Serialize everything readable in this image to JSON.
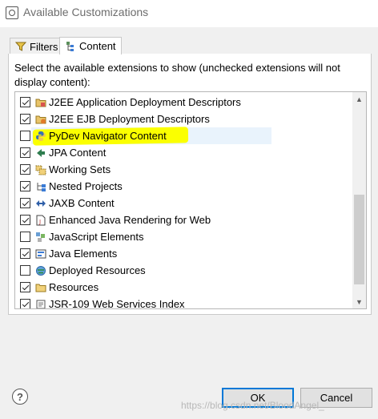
{
  "window": {
    "title": "Available Customizations",
    "icon": "customize-dialog-icon"
  },
  "tabs": [
    {
      "label": "Filters",
      "icon": "filter-icon",
      "active": false
    },
    {
      "label": "Content",
      "icon": "content-tree-icon",
      "active": true
    }
  ],
  "instructions": "Select the available extensions to show (unchecked extensions will not display content):",
  "extensions": [
    {
      "label": "J2EE Application Deployment Descriptors",
      "checked": true,
      "icon": "folder-descriptor-icon"
    },
    {
      "label": "J2EE EJB Deployment Descriptors",
      "checked": true,
      "icon": "ejb-descriptor-icon"
    },
    {
      "label": "PyDev Navigator Content",
      "checked": false,
      "icon": "python-icon",
      "selected": true,
      "highlighted": true
    },
    {
      "label": "JPA Content",
      "checked": true,
      "icon": "jpa-icon"
    },
    {
      "label": "Working Sets",
      "checked": true,
      "icon": "working-sets-icon"
    },
    {
      "label": "Nested Projects",
      "checked": true,
      "icon": "nested-projects-icon"
    },
    {
      "label": "JAXB Content",
      "checked": true,
      "icon": "jaxb-icon"
    },
    {
      "label": "Enhanced Java Rendering for Web",
      "checked": true,
      "icon": "java-file-icon"
    },
    {
      "label": "JavaScript Elements",
      "checked": false,
      "icon": "javascript-elements-icon"
    },
    {
      "label": "Java Elements",
      "checked": true,
      "icon": "java-elements-icon"
    },
    {
      "label": "Deployed Resources",
      "checked": false,
      "icon": "deployed-resources-icon"
    },
    {
      "label": "Resources",
      "checked": true,
      "icon": "resources-folder-icon"
    },
    {
      "label": "JSR-109 Web Services Index",
      "checked": true,
      "icon": "web-services-icon"
    }
  ],
  "buttons": {
    "ok": "OK",
    "cancel": "Cancel",
    "help": "?"
  },
  "watermark": "https://blog.csdn.net/BloodAngel_",
  "colors": {
    "highlight": "#fbff00",
    "selection": "#e9f3fc",
    "default_button_border": "#0078d7"
  }
}
